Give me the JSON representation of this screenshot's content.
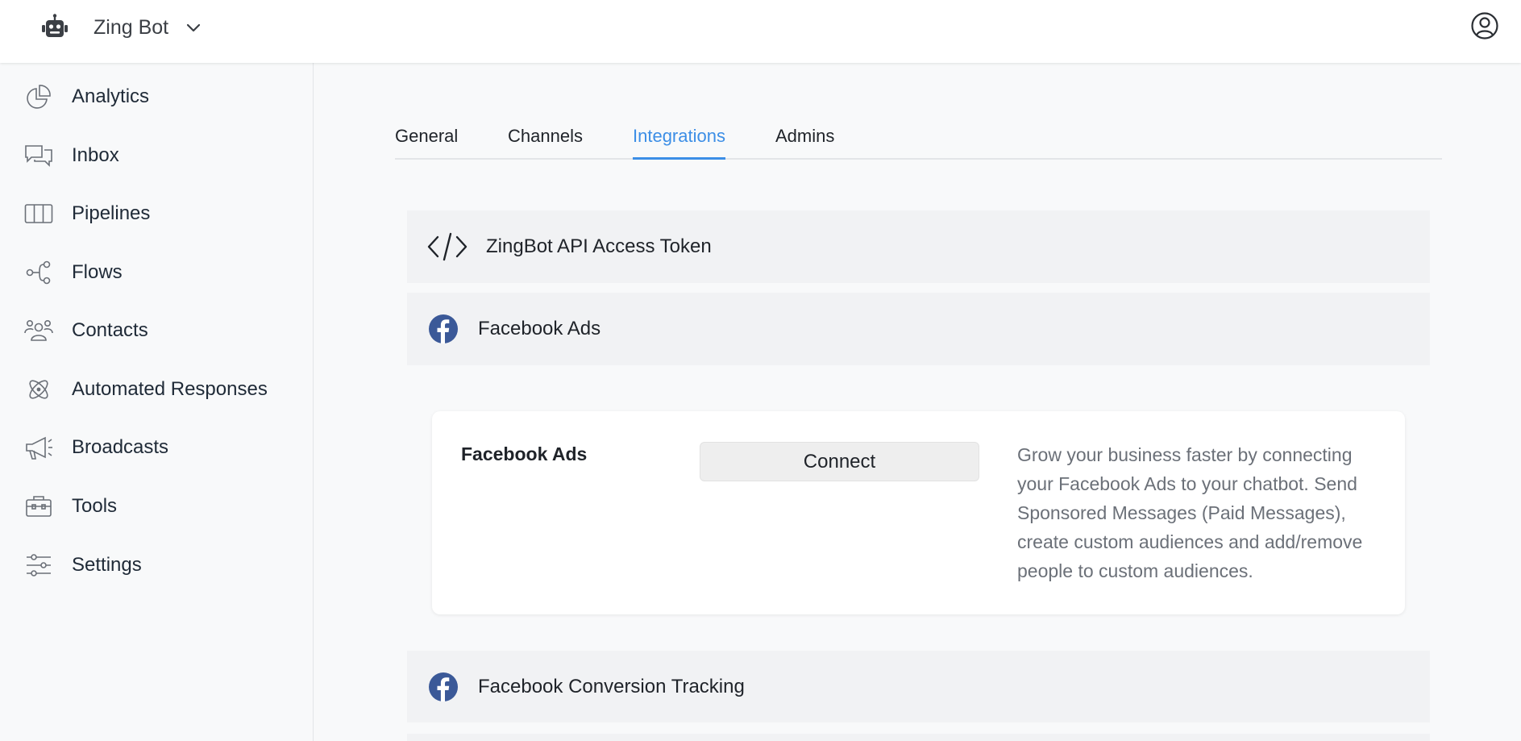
{
  "header": {
    "bot_name": "Zing Bot",
    "icons": {
      "bot": "robot-icon",
      "switch": "chevron-down-icon",
      "account": "user-circle-icon"
    }
  },
  "sidebar": {
    "items": [
      {
        "label": "Analytics",
        "icon": "pie-chart-icon"
      },
      {
        "label": "Inbox",
        "icon": "chat-bubbles-icon"
      },
      {
        "label": "Pipelines",
        "icon": "columns-icon"
      },
      {
        "label": "Flows",
        "icon": "flow-nodes-icon"
      },
      {
        "label": "Contacts",
        "icon": "users-icon"
      },
      {
        "label": "Automated Responses",
        "icon": "atom-icon"
      },
      {
        "label": "Broadcasts",
        "icon": "megaphone-icon"
      },
      {
        "label": "Tools",
        "icon": "toolbox-icon"
      },
      {
        "label": "Settings",
        "icon": "sliders-icon"
      }
    ]
  },
  "tabs": [
    {
      "label": "General"
    },
    {
      "label": "Channels"
    },
    {
      "label": "Integrations",
      "active": true
    },
    {
      "label": "Admins"
    }
  ],
  "integrations": {
    "api_token": {
      "label": "ZingBot API Access Token",
      "icon": "code-icon"
    },
    "facebook_ads": {
      "label": "Facebook Ads",
      "icon": "facebook-icon",
      "card": {
        "title": "Facebook Ads",
        "button": "Connect",
        "description": "Grow your business faster by connecting your Facebook Ads to your chatbot. Send Sponsored Messages (Paid Messages), create custom audiences and add/remove people to custom audiences."
      }
    },
    "conversion_tracking": {
      "label": "Facebook Conversion Tracking",
      "icon": "facebook-icon"
    }
  },
  "colors": {
    "accent": "#3c8ee6",
    "facebook": "#3b5998",
    "panel_bg": "#f1f2f4",
    "page_bg": "#f8f9fa"
  }
}
